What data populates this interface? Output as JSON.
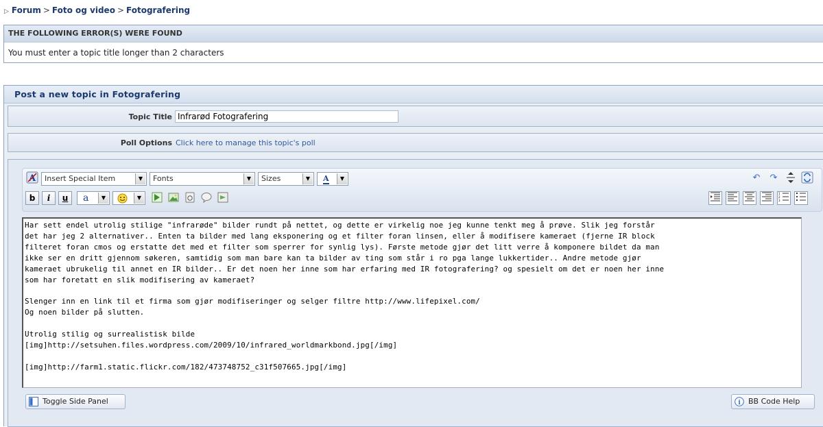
{
  "breadcrumb": {
    "items": [
      "Forum",
      "Foto og video",
      "Fotografering"
    ],
    "separator": ">"
  },
  "error": {
    "header": "THE FOLLOWING ERROR(S) WERE FOUND",
    "message": "You must enter a topic title longer than 2 characters"
  },
  "form": {
    "title": "Post a new topic in Fotografering",
    "topic_title_label": "Topic Title",
    "topic_title_value": "Infrarød Fotografering",
    "poll_label": "Poll Options",
    "poll_link": "Click here to manage this topic's poll"
  },
  "toolbar": {
    "special_item": "Insert Special Item",
    "fonts": "Fonts",
    "sizes": "Sizes",
    "font_color_glyph": "A",
    "bold": "b",
    "italic": "i",
    "underline": "u",
    "text_glyph": "a"
  },
  "editor": {
    "content": "Har sett endel utrolig stilige \"infrarøde\" bilder rundt på nettet, og dette er virkelig noe jeg kunne tenkt meg å prøve. Slik jeg forstår\ndet har jeg 2 alternativer.. Enten ta bilder med lang eksponering og et filter foran linsen, eller å modifisere kameraet (fjerne IR block\nfilteret foran cmos og erstatte det med et filter som sperrer for synlig lys). Første metode gjør det litt verre å komponere bildet da man\nikke ser en dritt gjennom søkeren, samtidig som man bare kan ta bilder av ting som står i ro pga lange lukkertider.. Andre metode gjør\nkameraet ubrukelig til annet en IR bilder.. Er det noen her inne som har erfaring med IR fotografering? og spesielt om det er noen her inne\nsom har foretatt en slik modifisering av kameraet?\n\nSlenger inn en link til et firma som gjør modifiseringer og selger filtre http://www.lifepixel.com/\nOg noen bilder på slutten.\n\nUtrolig stilig og surrealistisk bilde\n[img]http://setsuhen.files.wordpress.com/2009/10/infrared_worldmarkbond.jpg[/img]\n\n[img]http://farm1.static.flickr.com/182/473748752_c31f507665.jpg[/img]"
  },
  "footer": {
    "toggle_label": "Toggle Side Panel",
    "help_label": "BB Code Help"
  }
}
